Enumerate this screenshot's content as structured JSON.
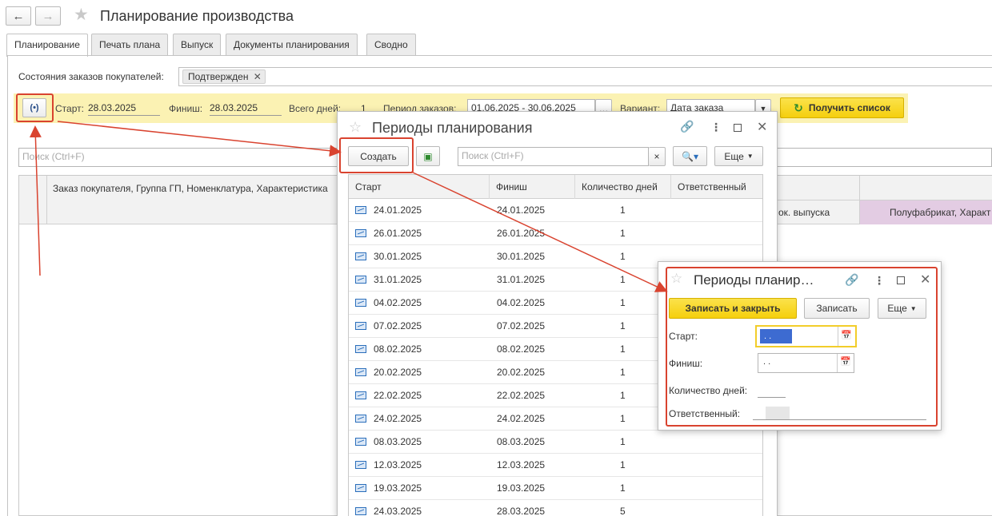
{
  "window": {
    "title": "Планирование производства"
  },
  "nav": {
    "back_icon": "arrow-left-icon",
    "forward_icon": "arrow-right-icon"
  },
  "tabs": [
    {
      "label": "Планирование",
      "active": true
    },
    {
      "label": "Печать плана",
      "active": false
    },
    {
      "label": "Выпуск",
      "active": false
    },
    {
      "label": "Документы планирования",
      "active": false
    },
    {
      "label": "Сводно",
      "active": false
    }
  ],
  "filters": {
    "order_states_label": "Состояния заказов покупателей:",
    "order_state_tag": "Подтвержден",
    "start_label": "Старт:",
    "start_value": "28.03.2025",
    "finish_label": "Финиш:",
    "finish_value": "28.03.2025",
    "total_days_label": "Всего дней:",
    "total_days_value": "1",
    "order_period_label": "Период заказов:",
    "order_period_value": "01.06.2025 - 30.06.2025",
    "variant_label": "Вариант:",
    "variant_value": "Дата заказа",
    "get_list_button": "Получить список"
  },
  "main_search": {
    "placeholder": "Поиск (Ctrl+F)"
  },
  "main_table": {
    "header_col1": "Заказ покупателя, Группа ГП, Номенклатура, Характеристика",
    "header_col_docs": "ок. выпуска",
    "header_col_semi": "Полуфабрикат, Характ"
  },
  "periods_dialog": {
    "title": "Периоды планирования",
    "create_button": "Создать",
    "search_placeholder": "Поиск (Ctrl+F)",
    "more_button": "Еще",
    "columns": [
      "Старт",
      "Финиш",
      "Количество дней",
      "Ответственный"
    ],
    "rows": [
      {
        "start": "24.01.2025",
        "finish": "24.01.2025",
        "days": "1"
      },
      {
        "start": "26.01.2025",
        "finish": "26.01.2025",
        "days": "1"
      },
      {
        "start": "30.01.2025",
        "finish": "30.01.2025",
        "days": "1"
      },
      {
        "start": "31.01.2025",
        "finish": "31.01.2025",
        "days": "1"
      },
      {
        "start": "04.02.2025",
        "finish": "04.02.2025",
        "days": "1"
      },
      {
        "start": "07.02.2025",
        "finish": "07.02.2025",
        "days": "1"
      },
      {
        "start": "08.02.2025",
        "finish": "08.02.2025",
        "days": "1"
      },
      {
        "start": "20.02.2025",
        "finish": "20.02.2025",
        "days": "1"
      },
      {
        "start": "22.02.2025",
        "finish": "22.02.2025",
        "days": "1"
      },
      {
        "start": "24.02.2025",
        "finish": "24.02.2025",
        "days": "1"
      },
      {
        "start": "08.03.2025",
        "finish": "08.03.2025",
        "days": "1"
      },
      {
        "start": "12.03.2025",
        "finish": "12.03.2025",
        "days": "1"
      },
      {
        "start": "19.03.2025",
        "finish": "19.03.2025",
        "days": "1"
      },
      {
        "start": "24.03.2025",
        "finish": "28.03.2025",
        "days": "5"
      }
    ]
  },
  "period_form": {
    "title": "Периоды планир…",
    "save_close_button": "Записать и закрыть",
    "save_button": "Записать",
    "more_button": "Еще",
    "start_label": "Старт:",
    "start_value": " .  .",
    "finish_label": "Финиш:",
    "finish_value": " .  .",
    "days_label": "Количество дней:",
    "responsible_label": "Ответственный:"
  },
  "colors": {
    "accent_yellow": "#f5cf0d",
    "highlight_red": "#d9432f",
    "filter_panel": "#fbf2b3"
  }
}
